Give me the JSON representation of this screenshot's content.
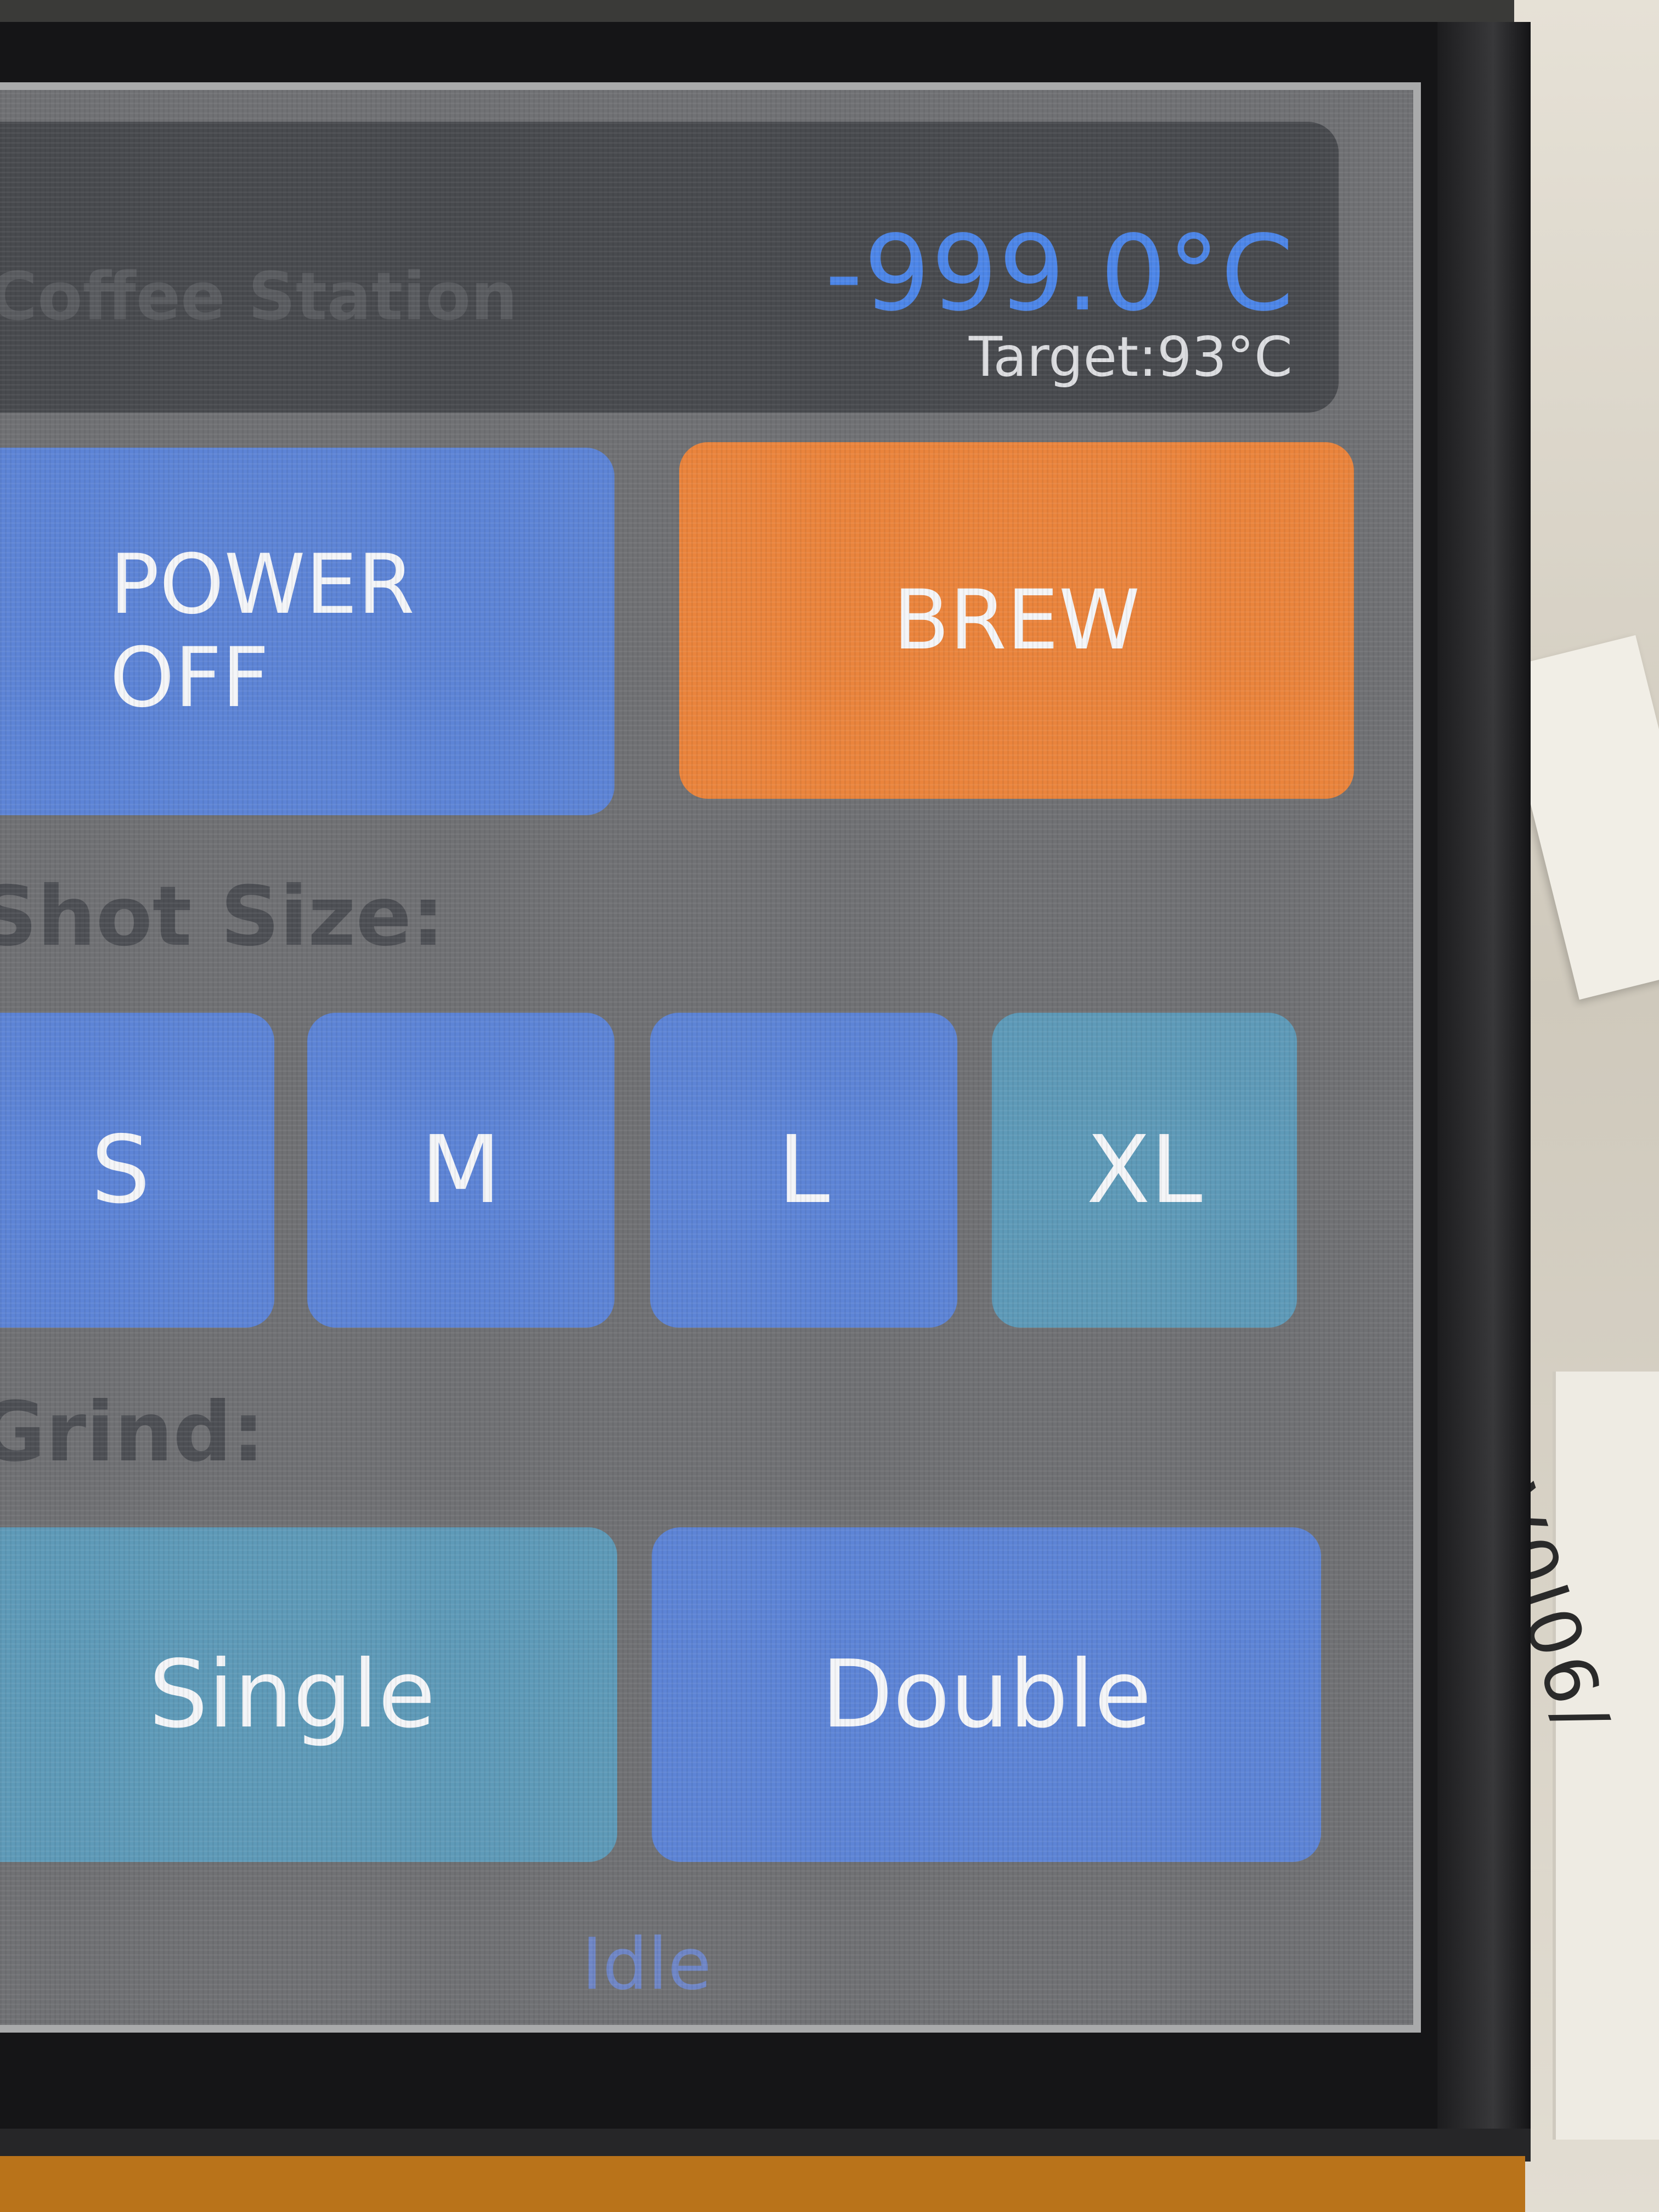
{
  "header": {
    "app_title": "Coffee Station",
    "temperature": "-999.0°C",
    "target": "Target:93°C"
  },
  "controls": {
    "power_label_line1": "POWER",
    "power_label_line2": "OFF",
    "brew_label": "BREW"
  },
  "shot_size": {
    "label": "Shot Size:",
    "options": [
      "S",
      "M",
      "L",
      "XL"
    ],
    "selected": "XL"
  },
  "grind": {
    "label": "Grind:",
    "options": [
      "Single",
      "Double"
    ],
    "selected": "Single"
  },
  "status": "Idle",
  "colors": {
    "screen_bg": "#707174",
    "header_bg": "#484a4e",
    "button_blue": "#5d84d6",
    "button_selected": "#5e9ab8",
    "button_brew": "#ea843c",
    "temperature_text": "#4d86e8"
  },
  "background_handwriting": "V0I06/"
}
